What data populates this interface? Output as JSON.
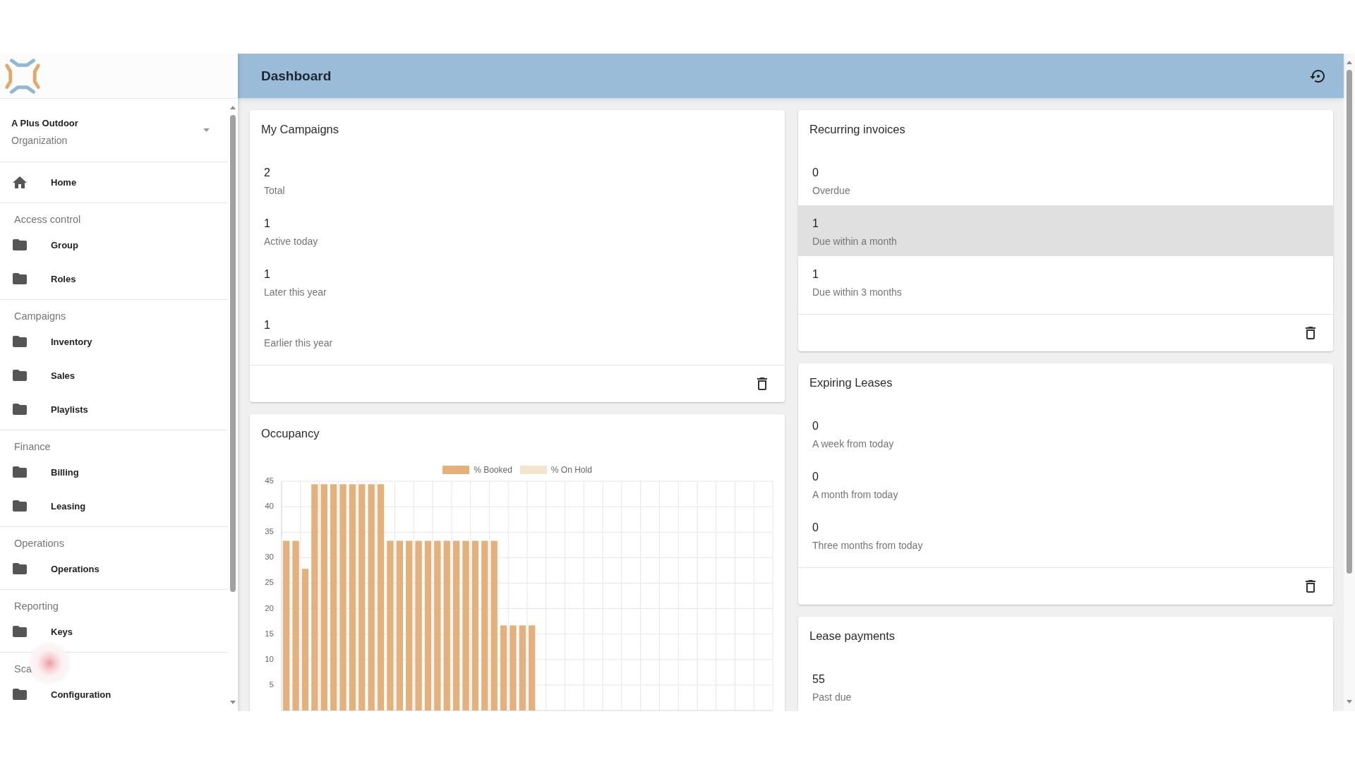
{
  "sidebar": {
    "organization": {
      "name": "A Plus Outdoor",
      "type": "Organization"
    },
    "home": {
      "label": "Home"
    },
    "sections": [
      {
        "title": "Access control",
        "items": [
          {
            "label": "Group"
          },
          {
            "label": "Roles"
          }
        ]
      },
      {
        "title": "Campaigns",
        "items": [
          {
            "label": "Inventory"
          },
          {
            "label": "Sales"
          },
          {
            "label": "Playlists"
          }
        ]
      },
      {
        "title": "Finance",
        "items": [
          {
            "label": "Billing"
          },
          {
            "label": "Leasing"
          }
        ]
      },
      {
        "title": "Operations",
        "items": [
          {
            "label": "Operations"
          }
        ]
      },
      {
        "title": "Reporting",
        "items": [
          {
            "label": "Keys"
          }
        ]
      },
      {
        "title": "Sca",
        "items": [
          {
            "label": "Configuration"
          }
        ]
      }
    ]
  },
  "header": {
    "title": "Dashboard"
  },
  "dashboard": {
    "left_column": [
      {
        "kind": "stats",
        "title": "My Campaigns",
        "deletable": true,
        "stats": [
          {
            "value": "2",
            "label": "Total",
            "highlighted": false
          },
          {
            "value": "1",
            "label": "Active today",
            "highlighted": false
          },
          {
            "value": "1",
            "label": "Later this year",
            "highlighted": false
          },
          {
            "value": "1",
            "label": "Earlier this year",
            "highlighted": false
          }
        ]
      },
      {
        "kind": "chart",
        "title": "Occupancy",
        "chart_data": {
          "type": "bar",
          "stacked": true,
          "grid": true,
          "ylim": [
            0,
            45
          ],
          "yticks": [
            5,
            10,
            15,
            20,
            25,
            30,
            35,
            40,
            45
          ],
          "series": [
            {
              "name": "% Booked",
              "color": "#e4b07b",
              "values": [
                33.3,
                33.3,
                27.8,
                44.4,
                44.4,
                44.4,
                44.4,
                44.4,
                44.4,
                44.4,
                44.4,
                33.3,
                33.3,
                33.3,
                33.3,
                33.3,
                33.3,
                33.3,
                33.3,
                33.3,
                33.3,
                33.3,
                33.3,
                16.7,
                16.7,
                16.7,
                16.7,
                0,
                0,
                0,
                0,
                0,
                0,
                0,
                0,
                0,
                0,
                0,
                0,
                0,
                0,
                0,
                0,
                0,
                0,
                0,
                0,
                0,
                0,
                0,
                0,
                0
              ]
            },
            {
              "name": "% On Hold",
              "color": "#f3e4cf",
              "values": [
                0,
                0,
                0,
                0,
                0,
                0,
                0,
                0,
                0,
                0,
                0,
                0,
                0,
                0,
                0,
                0,
                0,
                0,
                0,
                0,
                0,
                0,
                0,
                0,
                0,
                0,
                0,
                0,
                0,
                0,
                0,
                0,
                0,
                0,
                0,
                0,
                0,
                0,
                0,
                0,
                0,
                0,
                0,
                0,
                0,
                0,
                0,
                0,
                0,
                0,
                0,
                0
              ]
            }
          ]
        }
      }
    ],
    "right_column": [
      {
        "kind": "stats",
        "title": "Recurring invoices",
        "deletable": true,
        "stats": [
          {
            "value": "0",
            "label": "Overdue",
            "highlighted": false
          },
          {
            "value": "1",
            "label": "Due within a month",
            "highlighted": true
          },
          {
            "value": "1",
            "label": "Due within 3 months",
            "highlighted": false
          }
        ]
      },
      {
        "kind": "stats",
        "title": "Expiring Leases",
        "deletable": true,
        "stats": [
          {
            "value": "0",
            "label": "A week from today",
            "highlighted": false
          },
          {
            "value": "0",
            "label": "A month from today",
            "highlighted": false
          },
          {
            "value": "0",
            "label": "Three months from today",
            "highlighted": false
          }
        ]
      },
      {
        "kind": "stats",
        "title": "Lease payments",
        "stats": [
          {
            "value": "55",
            "label": "Past due",
            "highlighted": false
          }
        ]
      }
    ]
  }
}
